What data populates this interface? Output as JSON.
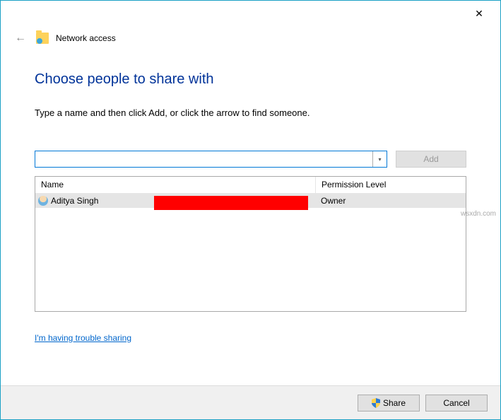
{
  "window": {
    "title": "Network access"
  },
  "heading": "Choose people to share with",
  "instruction": "Type a name and then click Add, or click the arrow to find someone.",
  "input": {
    "value": "",
    "placeholder": ""
  },
  "buttons": {
    "add": "Add",
    "share": "Share",
    "cancel": "Cancel"
  },
  "columns": {
    "name": "Name",
    "permission": "Permission Level"
  },
  "rows": [
    {
      "name": "Aditya Singh",
      "permission": "Owner"
    }
  ],
  "links": {
    "trouble": "I'm having trouble sharing"
  },
  "watermark": "wsxdn.com"
}
